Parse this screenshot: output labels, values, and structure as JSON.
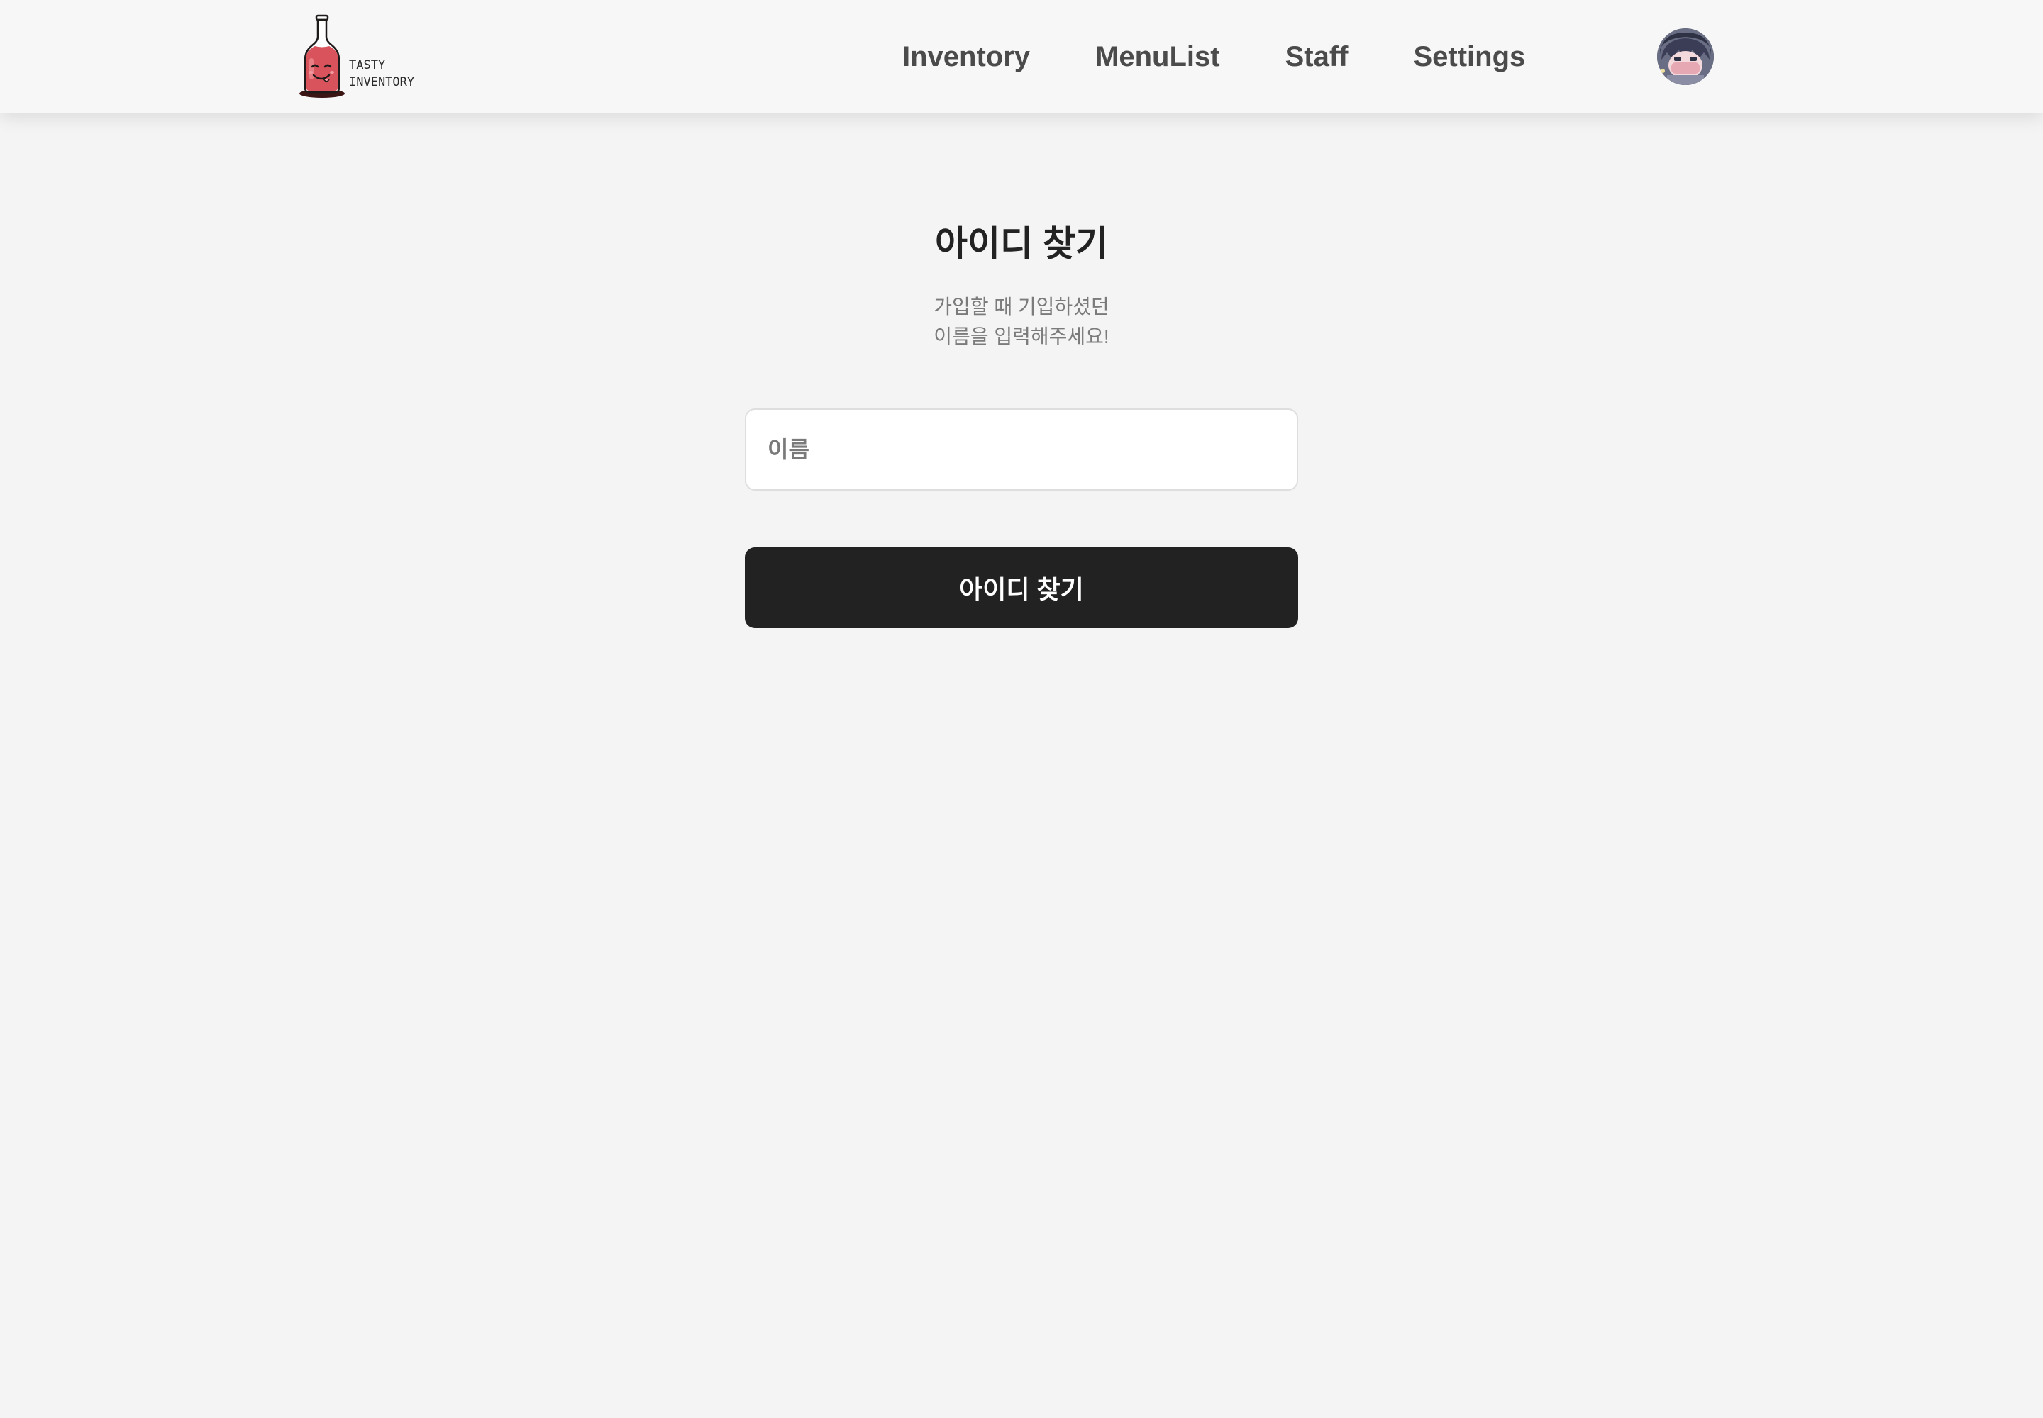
{
  "header": {
    "logo": {
      "line1": "TASTY",
      "line2": "INVENTORY",
      "icon": "bottle-mascot-icon",
      "colors": {
        "bottle": "#d9535c",
        "outline": "#1f1a1a",
        "label": "#2a2a2a"
      }
    },
    "nav": [
      {
        "label": "Inventory"
      },
      {
        "label": "MenuList"
      },
      {
        "label": "Staff"
      },
      {
        "label": "Settings"
      }
    ],
    "avatar": {
      "icon": "user-avatar-icon"
    }
  },
  "main": {
    "title": "아이디 찾기",
    "subtitle_line1": "가입할 때 기입하셨던",
    "subtitle_line2": "이름을 입력해주세요!",
    "name_input": {
      "placeholder": "이름",
      "value": ""
    },
    "submit_label": "아이디 찾기"
  },
  "colors": {
    "page_background": "#f4f4f4",
    "header_background": "#f7f7f7",
    "button_background": "#232223",
    "button_text": "#ffffff",
    "nav_text": "#4b4b4b"
  }
}
